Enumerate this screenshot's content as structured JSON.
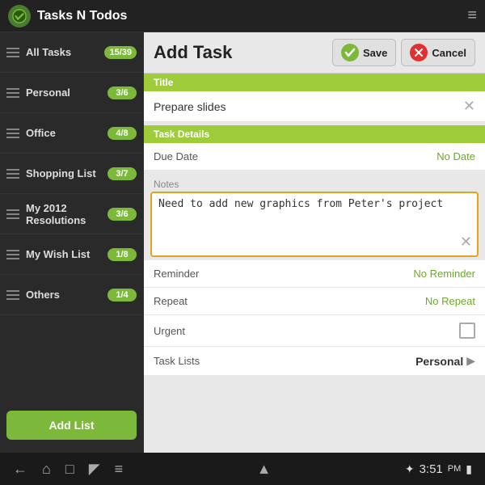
{
  "app": {
    "title": "Tasks N Todos",
    "menu_icon": "≡"
  },
  "sidebar": {
    "items": [
      {
        "name": "all-tasks",
        "label": "All Tasks",
        "badge": "15/39"
      },
      {
        "name": "personal",
        "label": "Personal",
        "badge": "3/6"
      },
      {
        "name": "office",
        "label": "Office",
        "badge": "4/8"
      },
      {
        "name": "shopping-list",
        "label": "Shopping List",
        "badge": "3/7"
      },
      {
        "name": "my-2012-resolutions",
        "label": "My 2012 Resolutions",
        "badge": "3/6"
      },
      {
        "name": "my-wish-list",
        "label": "My Wish List",
        "badge": "1/8"
      },
      {
        "name": "others",
        "label": "Others",
        "badge": "1/4"
      }
    ],
    "add_button_label": "Add List"
  },
  "form": {
    "header_title": "Add Task",
    "save_label": "Save",
    "cancel_label": "Cancel",
    "title_label": "Title",
    "title_value": "Prepare slides",
    "task_details_label": "Task Details",
    "due_date_label": "Due Date",
    "due_date_value": "No Date",
    "notes_label": "Notes",
    "notes_value": "Need to add new graphics from Peter's project",
    "reminder_label": "Reminder",
    "reminder_value": "No Reminder",
    "repeat_label": "Repeat",
    "repeat_value": "No Repeat",
    "urgent_label": "Urgent",
    "task_lists_label": "Task Lists",
    "task_lists_value": "Personal"
  },
  "bottom_bar": {
    "time": "3:51",
    "am_pm": "PM"
  }
}
